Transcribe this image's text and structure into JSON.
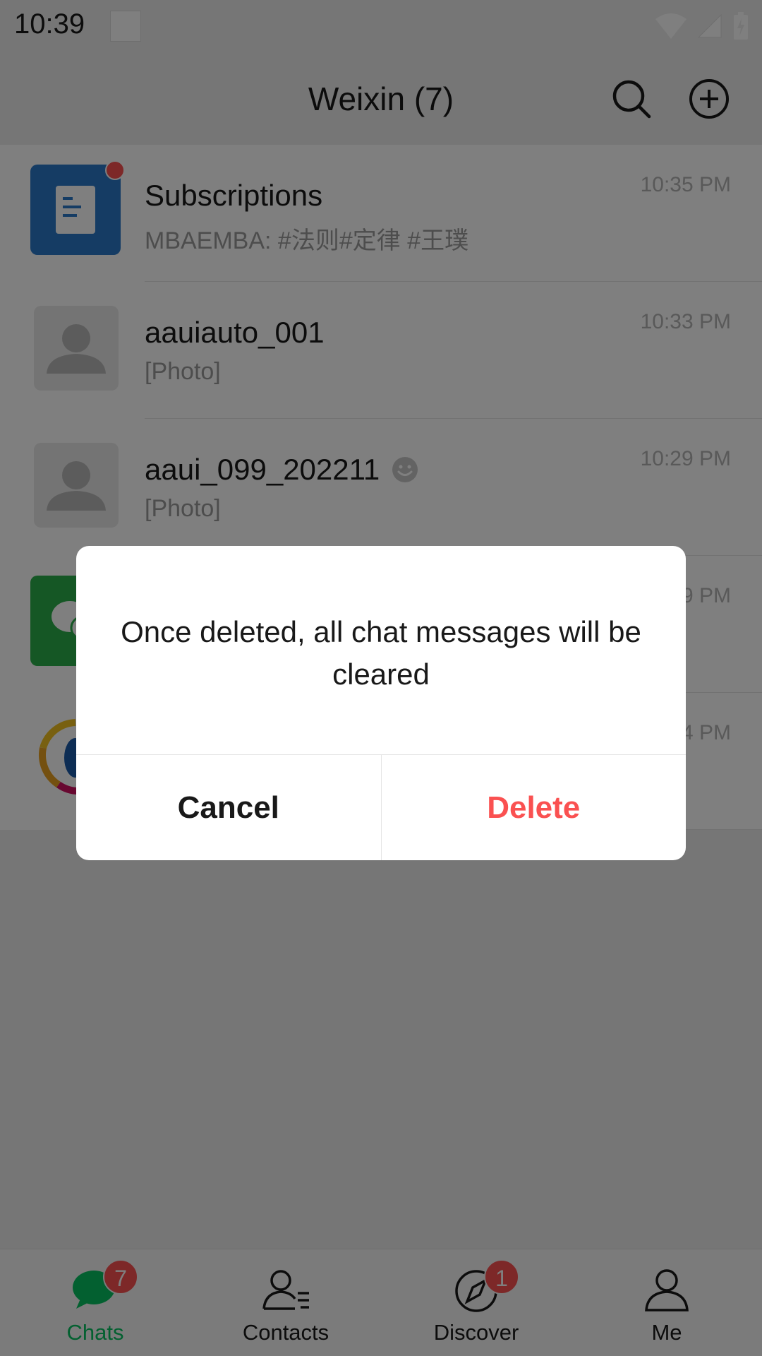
{
  "status_bar": {
    "time": "10:39"
  },
  "header": {
    "title": "Weixin (7)"
  },
  "chats": [
    {
      "name": "Subscriptions",
      "preview": "MBAEMBA: #法则#定律 #王璞",
      "time": "10:35 PM",
      "avatar": "subscriptions-icon",
      "unread_dot": true
    },
    {
      "name": "aauiauto_001",
      "preview": "[Photo]",
      "time": "10:33 PM",
      "avatar": "default-avatar-icon"
    },
    {
      "name": "aaui_099_202211",
      "preview": "[Photo]",
      "time": "10:29 PM",
      "avatar": "default-avatar-icon",
      "status_icon": "smiley-icon"
    },
    {
      "name": "",
      "preview": "",
      "time": "9 PM",
      "avatar": "group-chat-icon"
    },
    {
      "name": "",
      "preview": "",
      "time": "4 PM",
      "avatar": "colorful-logo-icon"
    }
  ],
  "dialog": {
    "message": "Once deleted, all chat messages will be cleared",
    "cancel_label": "Cancel",
    "delete_label": "Delete",
    "delete_color": "#fa5151"
  },
  "tabs": [
    {
      "label": "Chats",
      "icon": "chat-bubble-icon",
      "badge": "7",
      "active": true
    },
    {
      "label": "Contacts",
      "icon": "contacts-icon"
    },
    {
      "label": "Discover",
      "icon": "compass-icon",
      "badge": "1"
    },
    {
      "label": "Me",
      "icon": "person-icon"
    }
  ],
  "colors": {
    "accent": "#07c160",
    "badge": "#fa5151",
    "subscriptions": "#2a78c8",
    "group": "#2aae4a"
  }
}
